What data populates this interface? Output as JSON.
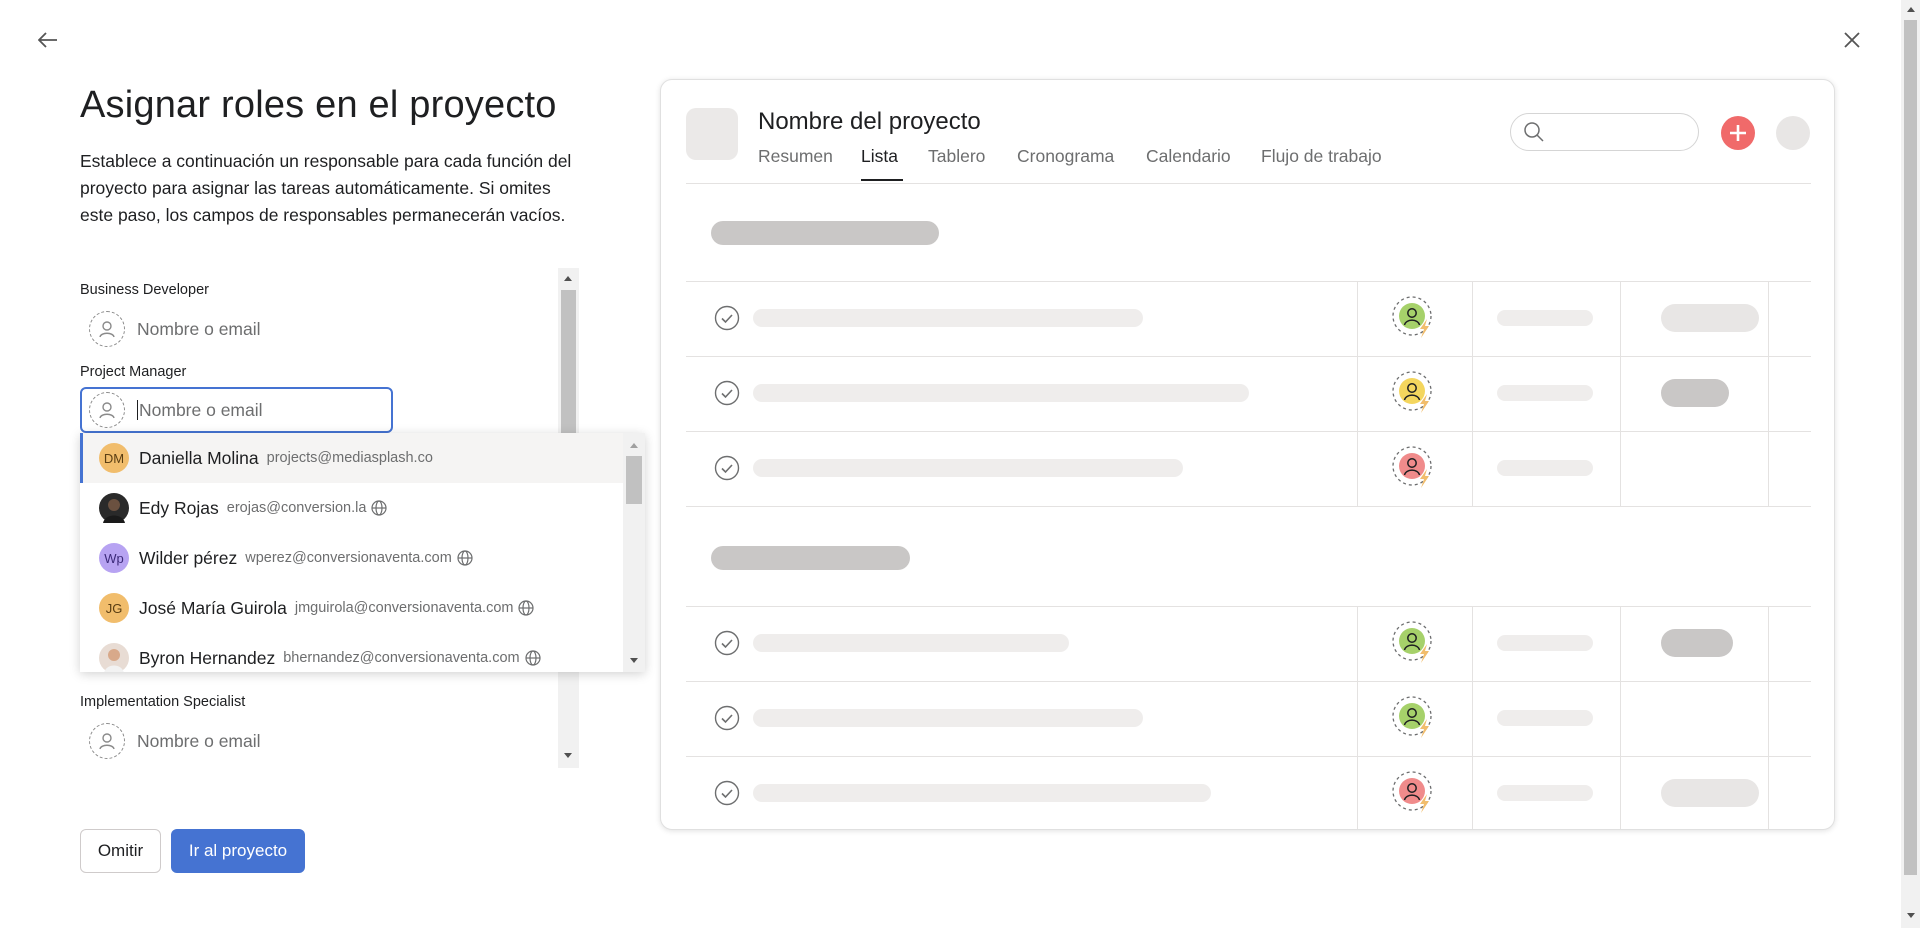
{
  "nav": {
    "back_icon": "arrow-left-icon",
    "close_icon": "close-icon"
  },
  "setup": {
    "title": "Asignar roles en el proyecto",
    "description": "Establece a continuación un responsable para cada función del proyecto para asignar las tareas automáticamente. Si omites este paso, los campos de responsables permanecerán vacíos.",
    "roles": [
      {
        "label": "Business Developer",
        "placeholder": "Nombre o email"
      },
      {
        "label": "Project Manager",
        "placeholder": "Nombre o email"
      },
      {
        "label": "Implementation Specialist",
        "placeholder": "Nombre o email"
      }
    ]
  },
  "dropdown": {
    "items": [
      {
        "name": "Daniella Molina",
        "email": "projects@mediasplash.co",
        "initials": "DM",
        "color": "#f1bd6c",
        "guest": false
      },
      {
        "name": "Edy Rojas",
        "email": "erojas@conversion.la",
        "initials": "",
        "color": "#2a2a2a",
        "guest": true
      },
      {
        "name": "Wilder pérez",
        "email": "wperez@conversionaventa.com",
        "initials": "Wp",
        "color": "#b7a3f2",
        "guest": true
      },
      {
        "name": "José María Guirola",
        "email": "jmguirola@conversionaventa.com",
        "initials": "JG",
        "color": "#f1bd6c",
        "guest": true
      },
      {
        "name": "Byron Hernandez",
        "email": "bhernandez@conversionaventa.com",
        "initials": "",
        "color": "#d9c9c0",
        "guest": true
      }
    ]
  },
  "actions": {
    "skip_label": "Omitir",
    "go_label": "Ir al proyecto"
  },
  "preview": {
    "project_name": "Nombre del proyecto",
    "tabs": [
      "Resumen",
      "Lista",
      "Tablero",
      "Cronograma",
      "Calendario",
      "Flujo de trabajo"
    ],
    "active_tab": "Lista",
    "colors": {
      "add": "#f06a6a",
      "green": "#a6d16a",
      "yellow": "#f4d65e",
      "red": "#f08b8b",
      "bolt": "#f1bd6c"
    }
  }
}
